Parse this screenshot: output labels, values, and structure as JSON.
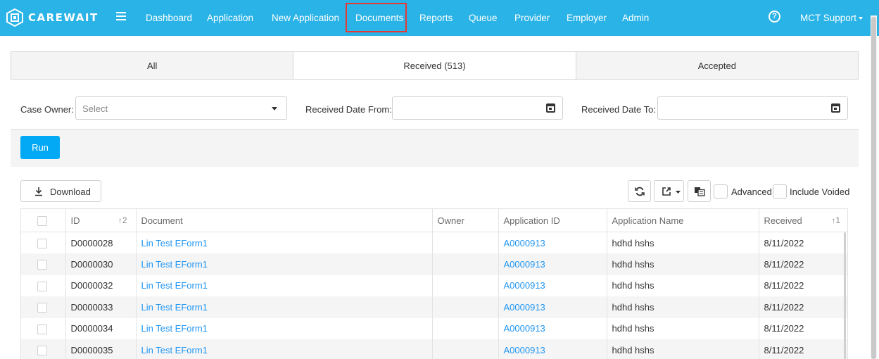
{
  "app": {
    "brand": "CAREWAIT"
  },
  "nav": {
    "items": [
      {
        "label": "Dashboard"
      },
      {
        "label": "Application"
      },
      {
        "label": "New Application"
      },
      {
        "label": "Documents"
      },
      {
        "label": "Reports"
      },
      {
        "label": "Queue"
      },
      {
        "label": "Provider"
      },
      {
        "label": "Employer"
      },
      {
        "label": "Admin"
      }
    ],
    "help_glyph": "?",
    "user_label": "MCT Support",
    "highlighted_item": "Documents",
    "highlight_color": "#e53935",
    "bar_color": "#2ab3e6"
  },
  "tabs": [
    {
      "label": "All"
    },
    {
      "label": "Received (513)",
      "active": true
    },
    {
      "label": "Accepted"
    }
  ],
  "filters": {
    "case_owner_label": "Case Owner:",
    "case_owner_placeholder": "Select",
    "date_from_label": "Received Date From:",
    "date_to_label": "Received Date To:",
    "run_label": "Run"
  },
  "toolbar": {
    "download_label": "Download",
    "advanced_label": "Advanced",
    "include_voided_label": "Include Voided",
    "icons": [
      "refresh-icon",
      "export-icon",
      "columns-icon",
      "download-icon"
    ]
  },
  "table": {
    "columns": [
      {
        "label": ""
      },
      {
        "label": "ID",
        "sort": "↑2"
      },
      {
        "label": "Document"
      },
      {
        "label": "Owner"
      },
      {
        "label": "Application ID"
      },
      {
        "label": "Application Name"
      },
      {
        "label": "Received",
        "sort": "↑1"
      }
    ],
    "rows": [
      {
        "id": "D0000028",
        "document": "Lin Test EForm1",
        "owner": "",
        "application_id": "A0000913",
        "application_name": "hdhd hshs",
        "received": "8/11/2022"
      },
      {
        "id": "D0000030",
        "document": "Lin Test EForm1",
        "owner": "",
        "application_id": "A0000913",
        "application_name": "hdhd hshs",
        "received": "8/11/2022"
      },
      {
        "id": "D0000032",
        "document": "Lin Test EForm1",
        "owner": "",
        "application_id": "A0000913",
        "application_name": "hdhd hshs",
        "received": "8/11/2022"
      },
      {
        "id": "D0000033",
        "document": "Lin Test EForm1",
        "owner": "",
        "application_id": "A0000913",
        "application_name": "hdhd hshs",
        "received": "8/11/2022"
      },
      {
        "id": "D0000034",
        "document": "Lin Test EForm1",
        "owner": "",
        "application_id": "A0000913",
        "application_name": "hdhd hshs",
        "received": "8/11/2022"
      },
      {
        "id": "D0000035",
        "document": "Lin Test EForm1",
        "owner": "",
        "application_id": "A0000913",
        "application_name": "hdhd hshs",
        "received": "8/11/2022"
      }
    ]
  }
}
